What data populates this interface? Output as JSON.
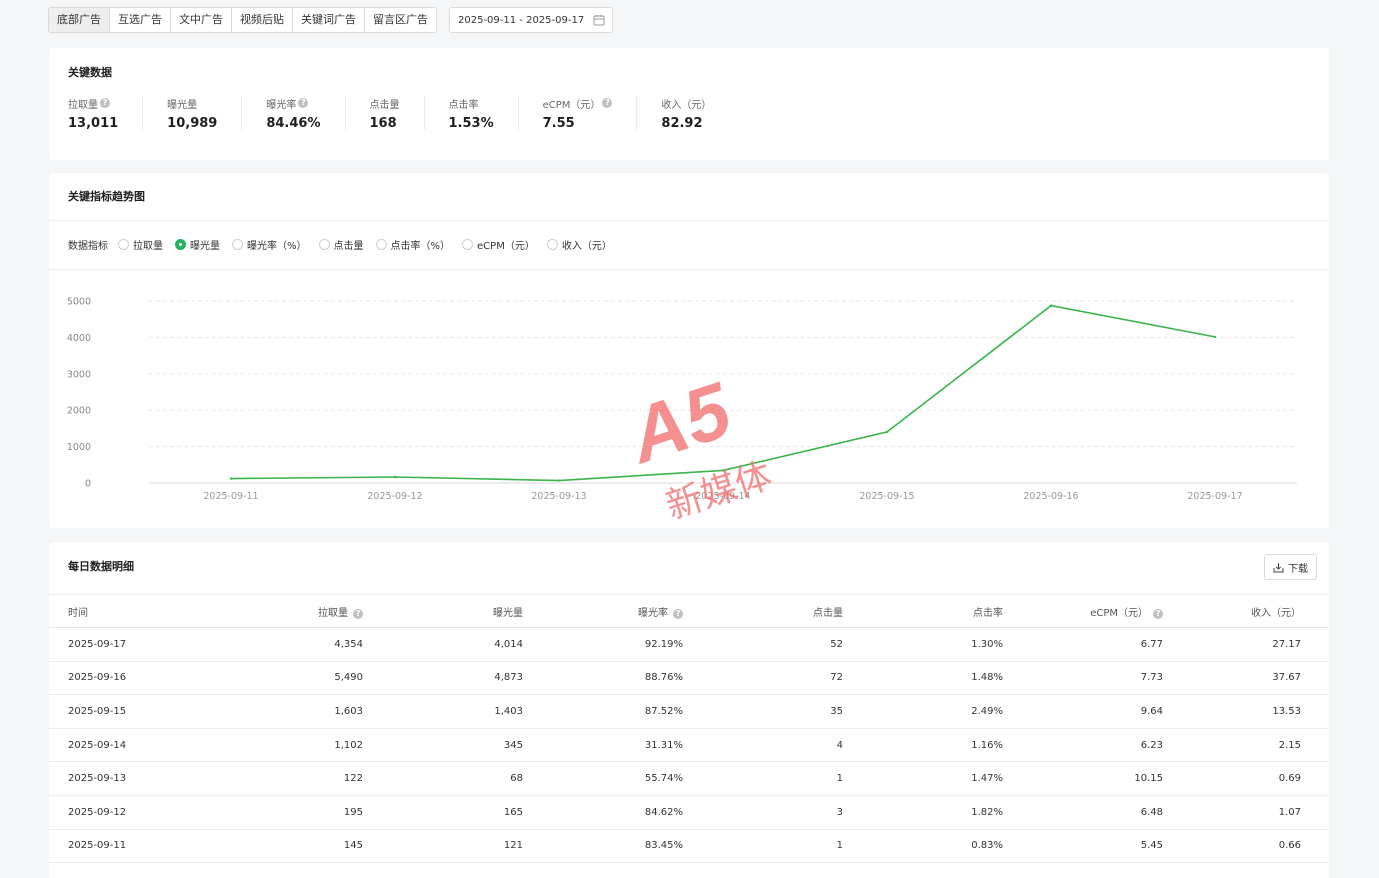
{
  "tabs": [
    "底部广告",
    "互选广告",
    "文中广告",
    "视频后贴",
    "关键词广告",
    "留言区广告"
  ],
  "active_tab": 0,
  "date_range": "2025-09-11 - 2025-09-17",
  "icons": {
    "calendar": "calendar-icon",
    "help": "help-icon",
    "download": "download-icon"
  },
  "key_data": {
    "title": "关键数据",
    "items": [
      {
        "label": "拉取量",
        "value": "13,011",
        "help": true
      },
      {
        "label": "曝光量",
        "value": "10,989",
        "help": false
      },
      {
        "label": "曝光率",
        "value": "84.46%",
        "help": true
      },
      {
        "label": "点击量",
        "value": "168",
        "help": false
      },
      {
        "label": "点击率",
        "value": "1.53%",
        "help": false
      },
      {
        "label": "eCPM（元）",
        "value": "7.55",
        "help": true
      },
      {
        "label": "收入（元）",
        "value": "82.92",
        "help": false
      }
    ]
  },
  "trend": {
    "title": "关键指标趋势图",
    "metric_label": "数据指标",
    "options": [
      "拉取量",
      "曝光量",
      "曝光率（%）",
      "点击量",
      "点击率（%）",
      "eCPM（元）",
      "收入（元）"
    ],
    "selected": 1
  },
  "chart_data": {
    "type": "line",
    "x": [
      "2025-09-11",
      "2025-09-12",
      "2025-09-13",
      "2025-09-14",
      "2025-09-15",
      "2025-09-16",
      "2025-09-17"
    ],
    "series": [
      {
        "values": [
          121,
          165,
          68,
          345,
          1403,
          4873,
          4014
        ]
      }
    ],
    "y_ticks": [
      0,
      1000,
      2000,
      3000,
      4000,
      5000
    ],
    "ylim": [
      0,
      5000
    ],
    "grid": true,
    "line_color": "#3bb44a"
  },
  "daily": {
    "title": "每日数据明细",
    "download_label": "下载",
    "columns": [
      {
        "label": "时间",
        "help": false
      },
      {
        "label": "拉取量",
        "help": true
      },
      {
        "label": "曝光量",
        "help": false
      },
      {
        "label": "曝光率",
        "help": true
      },
      {
        "label": "点击量",
        "help": false
      },
      {
        "label": "点击率",
        "help": false
      },
      {
        "label": "eCPM（元）",
        "help": true
      },
      {
        "label": "收入（元）",
        "help": false
      }
    ],
    "rows": [
      [
        "2025-09-17",
        "4,354",
        "4,014",
        "92.19%",
        "52",
        "1.30%",
        "6.77",
        "27.17"
      ],
      [
        "2025-09-16",
        "5,490",
        "4,873",
        "88.76%",
        "72",
        "1.48%",
        "7.73",
        "37.67"
      ],
      [
        "2025-09-15",
        "1,603",
        "1,403",
        "87.52%",
        "35",
        "2.49%",
        "9.64",
        "13.53"
      ],
      [
        "2025-09-14",
        "1,102",
        "345",
        "31.31%",
        "4",
        "1.16%",
        "6.23",
        "2.15"
      ],
      [
        "2025-09-13",
        "122",
        "68",
        "55.74%",
        "1",
        "1.47%",
        "10.15",
        "0.69"
      ],
      [
        "2025-09-12",
        "195",
        "165",
        "84.62%",
        "3",
        "1.82%",
        "6.48",
        "1.07"
      ],
      [
        "2025-09-11",
        "145",
        "121",
        "83.45%",
        "1",
        "0.83%",
        "5.45",
        "0.66"
      ]
    ]
  },
  "watermark": {
    "logo_text": "A5",
    "text": "新媒体",
    "color": "#f26b6b"
  }
}
